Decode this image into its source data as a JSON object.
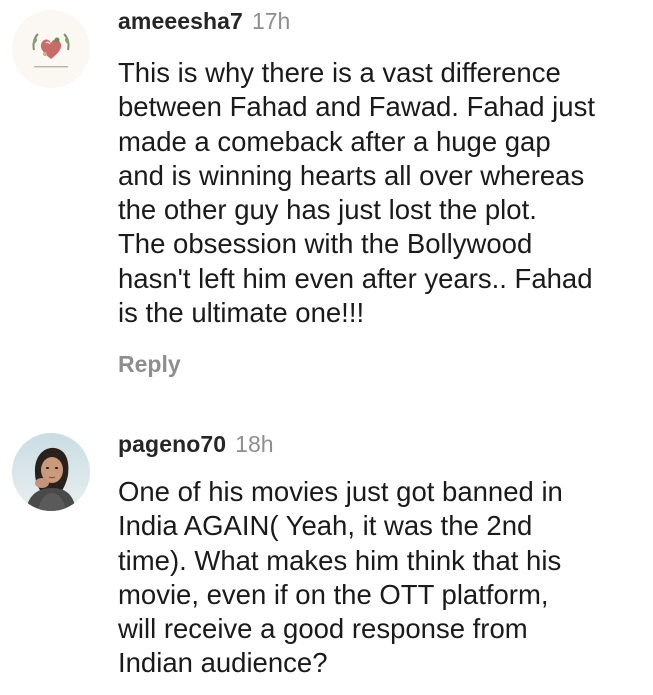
{
  "comments": [
    {
      "username": "ameeesha7",
      "time": "17h",
      "avatar_icon": "heart-wreath-avatar",
      "text_lines": [
        "This is why there is a vast difference",
        "between Fahad and Fawad. Fahad just",
        "made a comeback after a huge gap",
        "and is winning hearts all over whereas",
        "the other guy has just lost the plot.",
        "The obsession with the Bollywood",
        "hasn't left him even after years.. Fahad",
        "is the ultimate one!!!"
      ],
      "reply_label": "Reply"
    },
    {
      "username": "pageno70",
      "time": "18h",
      "avatar_icon": "user-photo-avatar",
      "text_lines": [
        "One of his movies just got banned in",
        "India AGAIN( Yeah, it was the 2nd",
        "time). What makes him think that his",
        "movie, even if on the OTT platform,",
        "will receive a good response from",
        "Indian audience?"
      ]
    }
  ],
  "colors": {
    "username": "#262626",
    "timestamp": "#8e8e8e",
    "body_text": "#1a1a1a",
    "reply": "#8e8e8e"
  }
}
